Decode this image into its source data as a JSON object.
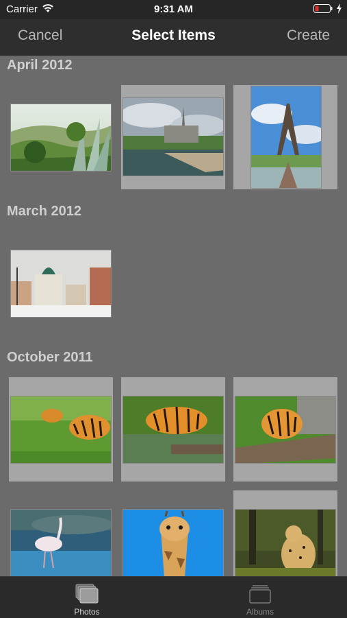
{
  "status_bar": {
    "carrier": "Carrier",
    "time": "9:31 AM"
  },
  "nav": {
    "cancel": "Cancel",
    "title": "Select Items",
    "create": "Create"
  },
  "sections": [
    {
      "title": "April 2012"
    },
    {
      "title": "March 2012"
    },
    {
      "title": "October 2011"
    }
  ],
  "tabs": [
    {
      "label": "Photos",
      "icon": "photos-stack-icon",
      "selected": true
    },
    {
      "label": "Albums",
      "icon": "albums-stack-icon",
      "selected": false
    }
  ],
  "colors": {
    "background": "#6b6b6b",
    "bars": "#2e2e2e",
    "selection": "#a6a6a6",
    "battery_low": "#e0302b"
  }
}
